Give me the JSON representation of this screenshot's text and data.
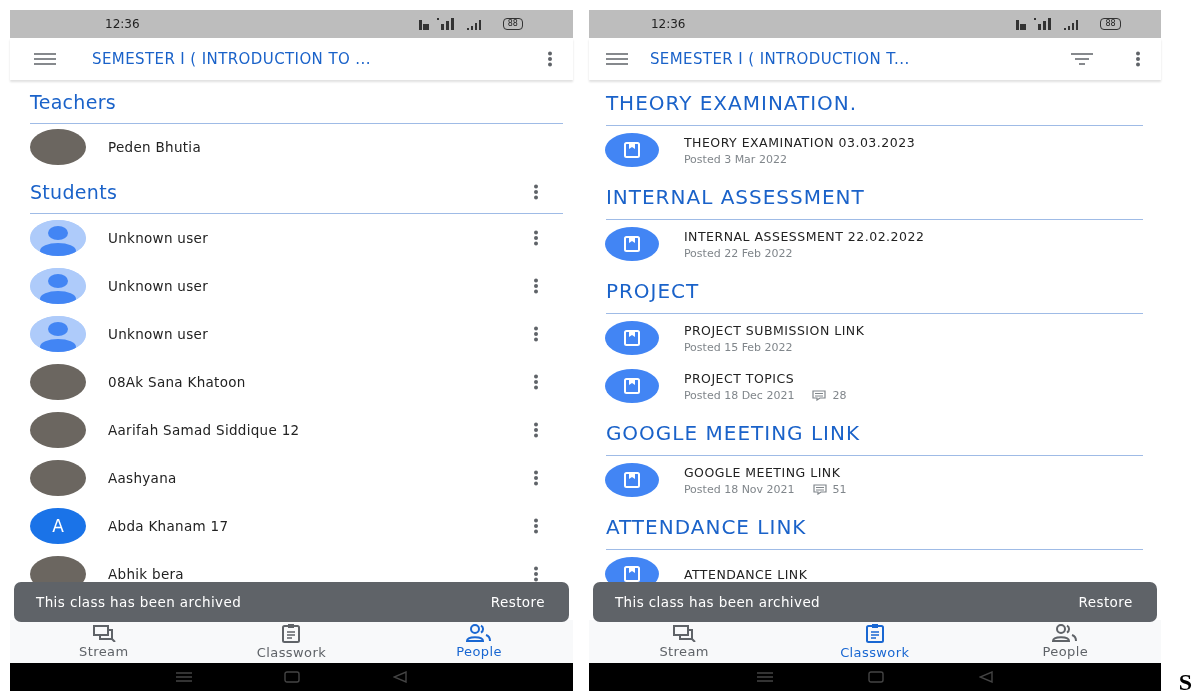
{
  "screens": [
    {
      "kind": "people",
      "status_bar": {
        "time": "12:36",
        "battery": "88"
      },
      "app_bar": {
        "title": "SEMESTER I ( INTRODUCTION TO ...",
        "filter": false
      },
      "sections": [
        {
          "title": "Teachers",
          "menu": false,
          "people": [
            {
              "name": "Peden Bhutia",
              "kind": "photo",
              "menu": false
            }
          ]
        },
        {
          "title": "Students",
          "menu": true,
          "people": [
            {
              "name": "Unknown user",
              "kind": "unknown",
              "menu": true
            },
            {
              "name": "Unknown user",
              "kind": "unknown",
              "menu": true
            },
            {
              "name": "Unknown user",
              "kind": "unknown",
              "menu": true
            },
            {
              "name": "08Ak Sana Khatoon",
              "kind": "photo",
              "menu": true
            },
            {
              "name": "Aarifah Samad Siddique 12",
              "kind": "photo",
              "menu": true
            },
            {
              "name": "Aashyana",
              "kind": "photo",
              "menu": true
            },
            {
              "name": "Abda Khanam 17",
              "kind": "letter",
              "initial": "A",
              "menu": true
            },
            {
              "name": "Abhik bera",
              "kind": "photo",
              "menu": true
            }
          ]
        }
      ],
      "snackbar": {
        "message": "This class has been archived",
        "action": "Restore"
      },
      "nav": [
        {
          "label": "Stream",
          "selected": false
        },
        {
          "label": "Classwork",
          "selected": false
        },
        {
          "label": "People",
          "selected": true
        }
      ]
    },
    {
      "kind": "classwork",
      "status_bar": {
        "time": "12:36",
        "battery": "88"
      },
      "app_bar": {
        "title": "SEMESTER I ( INTRODUCTION T...",
        "filter": true
      },
      "topics": [
        {
          "title": "THEORY EXAMINATION.",
          "items": [
            {
              "title": "THEORY EXAMINATION 03.03.2023",
              "posted": "Posted 3 Mar 2022"
            }
          ]
        },
        {
          "title": "INTERNAL ASSESSMENT",
          "items": [
            {
              "title": "INTERNAL ASSESSMENT 22.02.2022",
              "posted": "Posted 22 Feb 2022"
            }
          ]
        },
        {
          "title": "PROJECT",
          "items": [
            {
              "title": "PROJECT SUBMISSION LINK",
              "posted": "Posted 15 Feb 2022"
            },
            {
              "title": "PROJECT TOPICS",
              "posted": "Posted 18 Dec 2021",
              "comments": "28"
            }
          ]
        },
        {
          "title": "GOOGLE MEETING LINK",
          "items": [
            {
              "title": "GOOGLE MEETING LINK",
              "posted": "Posted 18 Nov 2021",
              "comments": "51"
            }
          ]
        },
        {
          "title": "ATTENDANCE LINK",
          "items": [
            {
              "title": "ATTENDANCE LINK"
            }
          ]
        }
      ],
      "snackbar": {
        "message": "This class has been archived",
        "action": "Restore"
      },
      "nav": [
        {
          "label": "Stream",
          "selected": false
        },
        {
          "label": "Classwork",
          "selected": true
        },
        {
          "label": "People",
          "selected": false
        }
      ]
    }
  ],
  "stray_text": "S"
}
